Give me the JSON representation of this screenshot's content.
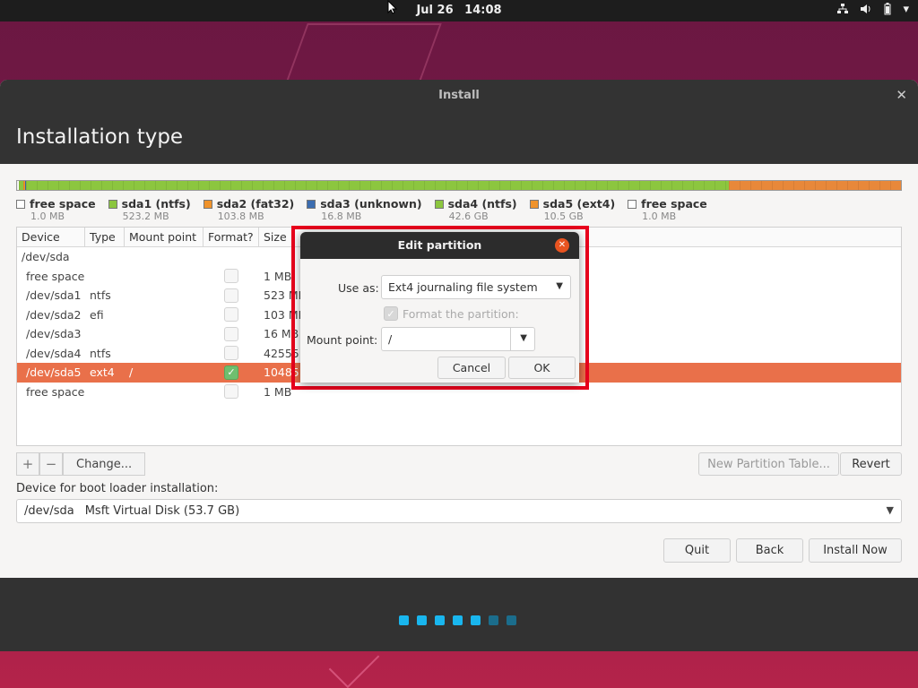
{
  "topbar": {
    "date": "Jul 26",
    "time": "14:08",
    "tray_icons": [
      "network-icon",
      "volume-icon",
      "battery-icon",
      "system-menu-icon"
    ]
  },
  "window": {
    "title": "Install",
    "page_title": "Installation type"
  },
  "partition_bar": [
    {
      "name": "free space",
      "color": "#ffffff",
      "fraction": 0.002
    },
    {
      "name": "sda1 (ntfs)",
      "color": "#8cc63f",
      "fraction": 0.005
    },
    {
      "name": "sda2 (fat32)",
      "color": "#f0932b",
      "fraction": 0.002
    },
    {
      "name": "sda3 (unknown)",
      "color": "#3c6db0",
      "fraction": 0.001
    },
    {
      "name": "sda4 (ntfs)",
      "color": "#8cc63f",
      "fraction": 0.795
    },
    {
      "name": "sda5 (ext4)",
      "color": "#e8883a",
      "fraction": 0.195
    }
  ],
  "legend": [
    {
      "label": "free space",
      "size": "1.0 MB",
      "color": "#ffffff"
    },
    {
      "label": "sda1 (ntfs)",
      "size": "523.2 MB",
      "color": "#8cc63f"
    },
    {
      "label": "sda2 (fat32)",
      "size": "103.8 MB",
      "color": "#f0932b"
    },
    {
      "label": "sda3 (unknown)",
      "size": "16.8 MB",
      "color": "#3c6db0"
    },
    {
      "label": "sda4 (ntfs)",
      "size": "42.6 GB",
      "color": "#8cc63f"
    },
    {
      "label": "sda5 (ext4)",
      "size": "10.5 GB",
      "color": "#f0932b"
    },
    {
      "label": "free space",
      "size": "1.0 MB",
      "color": "#ffffff"
    }
  ],
  "table": {
    "headers": [
      "Device",
      "Type",
      "Mount point",
      "Format?",
      "Size"
    ],
    "rows": [
      {
        "device": "/dev/sda",
        "type": "",
        "mount": "",
        "format": null,
        "size": ""
      },
      {
        "device": "free space",
        "type": "",
        "mount": "",
        "format": false,
        "size": "1 MB"
      },
      {
        "device": "/dev/sda1",
        "type": "ntfs",
        "mount": "",
        "format": false,
        "size": "523 MB"
      },
      {
        "device": "/dev/sda2",
        "type": "efi",
        "mount": "",
        "format": false,
        "size": "103 MB"
      },
      {
        "device": "/dev/sda3",
        "type": "",
        "mount": "",
        "format": false,
        "size": "16 MB"
      },
      {
        "device": "/dev/sda4",
        "type": "ntfs",
        "mount": "",
        "format": false,
        "size": "42555 MB"
      },
      {
        "device": "/dev/sda5",
        "type": "ext4",
        "mount": "/",
        "format": true,
        "size": "10485 MB",
        "selected": true
      },
      {
        "device": "free space",
        "type": "",
        "mount": "",
        "format": false,
        "size": "1 MB"
      }
    ]
  },
  "toolbar": {
    "add": "+",
    "remove": "−",
    "change": "Change...",
    "new_table": "New Partition Table...",
    "revert": "Revert"
  },
  "bootloader": {
    "label": "Device for boot loader installation:",
    "device": "/dev/sda",
    "model": "Msft Virtual Disk (53.7 GB)"
  },
  "nav": {
    "quit": "Quit",
    "back": "Back",
    "install": "Install Now"
  },
  "progress_dots": {
    "total": 7,
    "done": 5,
    "active_color": "#19b6ee",
    "inactive_color": "#1b6d8c"
  },
  "dialog": {
    "title": "Edit partition",
    "use_as_label": "Use as:",
    "use_as_value": "Ext4 journaling file system",
    "format_label": "Format the partition:",
    "mount_label": "Mount point:",
    "mount_value": "/",
    "cancel": "Cancel",
    "ok": "OK"
  }
}
